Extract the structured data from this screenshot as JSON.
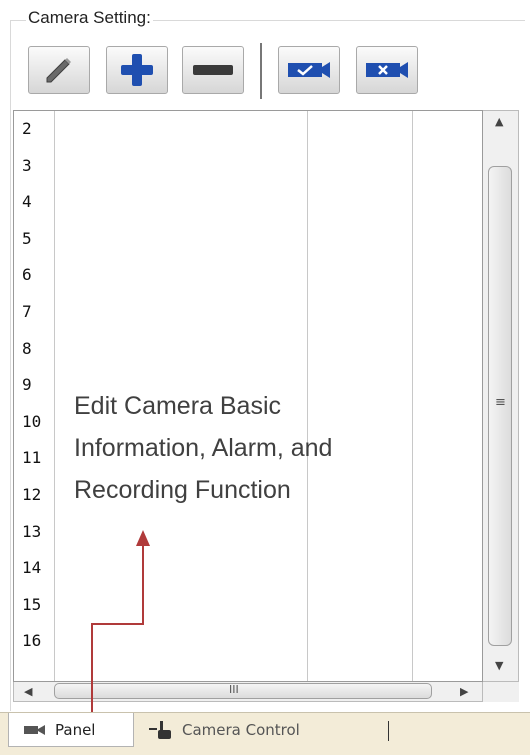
{
  "group": {
    "title": "Camera Setting:"
  },
  "toolbar": {
    "edit": "pencil-icon",
    "add": "plus-icon",
    "remove": "minus-icon",
    "confirm": "camera-check-icon",
    "cancel": "camera-x-icon"
  },
  "table": {
    "row_numbers": [
      "2",
      "3",
      "4",
      "5",
      "6",
      "7",
      "8",
      "9",
      "10",
      "11",
      "12",
      "13",
      "14",
      "15",
      "16"
    ]
  },
  "scrollbar": {
    "vertical_grip": "≡",
    "horizontal_grip": "III"
  },
  "annotation": {
    "line1": "Edit Camera Basic",
    "line2": "Information, Alarm, and",
    "line3": "Recording Function"
  },
  "tabs": [
    {
      "label": "Panel",
      "icon": "camera-icon"
    },
    {
      "label": "Camera Control",
      "icon": "hand-pointer-icon"
    }
  ],
  "colors": {
    "annotation_arrow": "#b03a3a",
    "toolbar_icon_blue": "#1f4fb0",
    "tab_bar": "#f3ecd8"
  }
}
